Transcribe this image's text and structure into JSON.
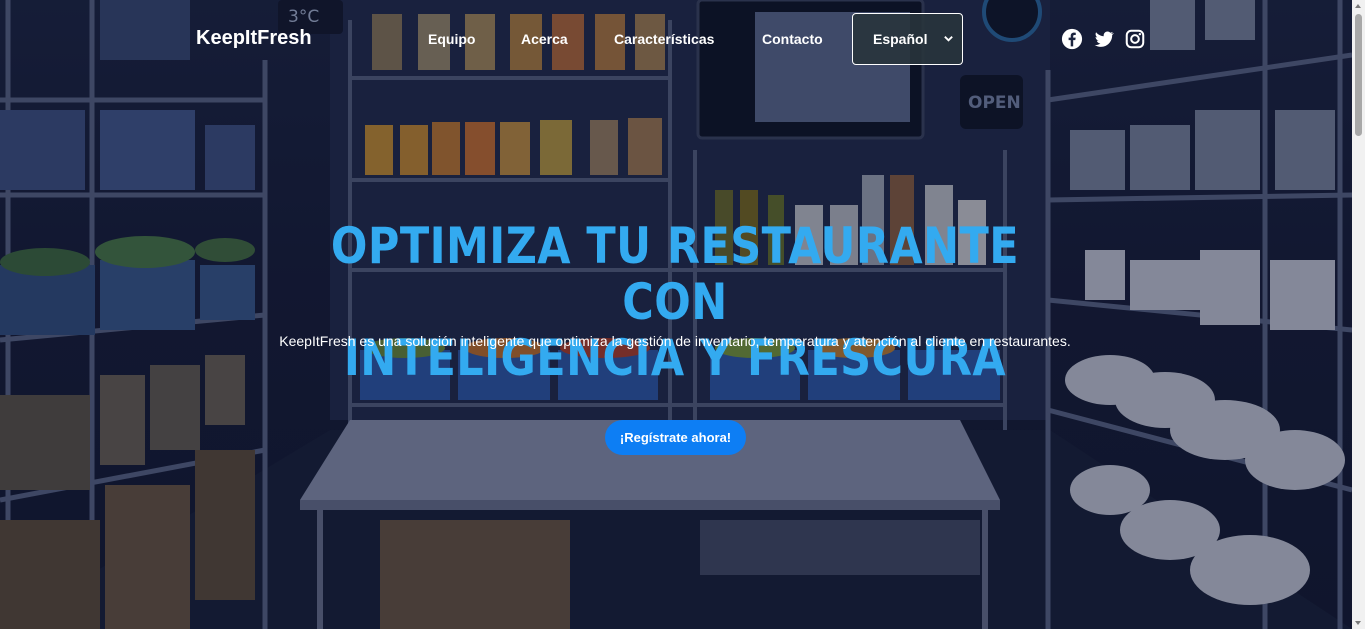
{
  "navbar": {
    "brand": "KeepItFresh",
    "links": [
      {
        "label": "Equipo"
      },
      {
        "label": "Acerca"
      },
      {
        "label": "Características"
      },
      {
        "label": "Contacto"
      }
    ],
    "language_select": {
      "value": "Español"
    },
    "social": [
      {
        "icon": "facebook-icon"
      },
      {
        "icon": "twitter-icon"
      },
      {
        "icon": "instagram-icon"
      }
    ]
  },
  "hero": {
    "title_line1": "OPTIMIZA TU RESTAURANTE CON",
    "title_line2": "INTELIGENCIA Y FRESCURA",
    "subtitle": "KeepItFresh es una solución inteligente que optimiza la gestión de inventario, temperatura y atención al cliente en restaurantes.",
    "cta_label": "¡Regístrate ahora!"
  },
  "background": {
    "wall_thermometer": "3°C",
    "door_sign": "OPEN"
  },
  "colors": {
    "title": "#33aaf0",
    "cta": "#0d7ef4",
    "text": "#ffffff"
  }
}
